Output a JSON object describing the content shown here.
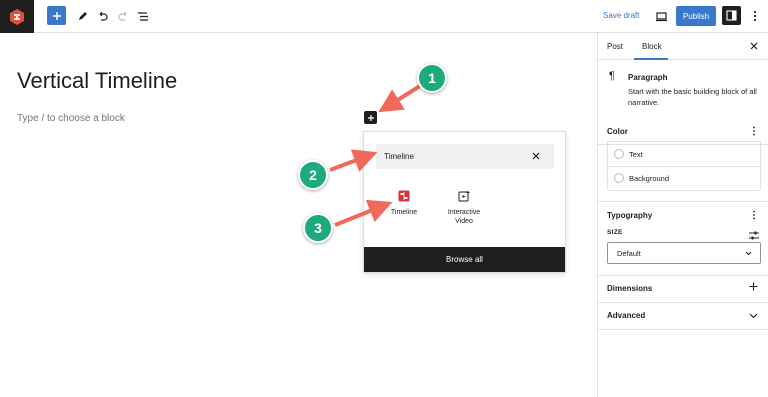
{
  "toolbar": {
    "save_draft": "Save draft",
    "publish": "Publish"
  },
  "editor": {
    "title": "Vertical Timeline",
    "placeholder": "Type / to choose a block"
  },
  "inserter": {
    "search_value": "Timeline",
    "results": [
      {
        "label": "Timeline",
        "icon": "timeline-icon"
      },
      {
        "label": "Interactive Video",
        "icon": "interactive-video-icon"
      }
    ],
    "browse_all": "Browse all"
  },
  "callouts": [
    "1",
    "2",
    "3"
  ],
  "sidebar": {
    "tabs": [
      "Post",
      "Block"
    ],
    "active_tab": "Block",
    "block": {
      "name": "Paragraph",
      "description": "Start with the basic building block of all narrative."
    },
    "color": {
      "title": "Color",
      "items": [
        "Text",
        "Background"
      ]
    },
    "typography": {
      "title": "Typography",
      "size_label": "SIZE",
      "size_value": "Default"
    },
    "dimensions": "Dimensions",
    "advanced": "Advanced"
  },
  "colors": {
    "accent": "#3a78c9",
    "callout": "#1eaa7e",
    "arrow": "#ef6a5a",
    "timeline_icon": "#d8323f"
  }
}
